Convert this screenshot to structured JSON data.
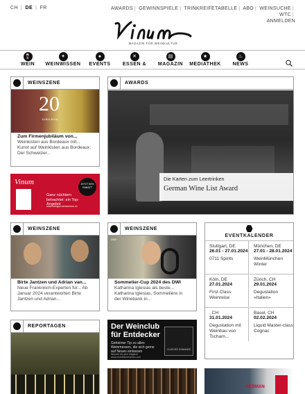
{
  "languages": [
    {
      "code": "CH",
      "active": false
    },
    {
      "code": "DE",
      "active": true
    },
    {
      "code": "FR",
      "active": false
    }
  ],
  "top_links": [
    "AWARDS",
    "GEWINNSPIELE",
    "TRINKREIFETABELLE",
    "ABO",
    "WEINSUCHE",
    "WTC",
    "ANMELDEN"
  ],
  "logo": {
    "text": "Vinum",
    "tagline": "MAGAZIN FÜR WEINKULTUR"
  },
  "nav": [
    {
      "label": "WEIN",
      "icon": "wine-glass-icon"
    },
    {
      "label": "WEINWISSEN",
      "icon": "grape-icon"
    },
    {
      "label": "EVENTS",
      "icon": "balloon-icon"
    },
    {
      "label": "ESSEN &",
      "icon": "cutlery-icon"
    },
    {
      "label": "MAGAZIN",
      "icon": "magazine-icon"
    },
    {
      "label": "MEDIATHEK",
      "icon": "star-icon"
    },
    {
      "label": "NEWS",
      "icon": "flame-icon"
    }
  ],
  "cards": {
    "weinszene1": {
      "category": "WEINSZENE",
      "image_text": "20",
      "image_subtext": "JUBILÄUM",
      "title": "Zum Firmenjubiläum von...",
      "text": "Weinkisten aus Bordeaux mit... Kunst auf Weinkisten aus Bordeaux: Der Schweizer..."
    },
    "awards": {
      "category": "AWARDS",
      "overlay_sub": "Die Karten zum Leertrinken",
      "overlay_title": "German Wine List Award"
    },
    "promo": {
      "logo": "Vinum",
      "text": "Ganz nüchtern betrachtet: ein Top-Angebot",
      "subtext": "Jetzt bestellen unter: www.vinum.ch",
      "url": "www.weingut-weinschenk.ch",
      "badge": "JETZT 50% RABATT"
    },
    "weinszene2": {
      "category": "WEINSZENE",
      "title": "Birte Jantzen und Adrian van...",
      "text": "Neue Frankreich-Experten für... Ab Januar 2024 verantworten Birte Jantzen und Adrian..."
    },
    "weinszene3": {
      "category": "WEINSZENE",
      "image_badge": "DWI",
      "title": "Sommelier-Cup 2024 des DWI",
      "text": "Katharina Iglesias als beste... Katharina Iglesias, Sommelière in der Winebank in..."
    },
    "reportagen": {
      "category": "REPORTAGEN"
    },
    "weinclub": {
      "title": "Der Weinclub für Entdecker",
      "text": "Geheimer Tip zu allen Weinmessen, die sich gerne auf Neues einlassen",
      "footer": "Wunder bis jetzt Mitglied! www.clubdesdomaines.com",
      "brand": "CLUB DES DOMAINES"
    },
    "bottom_right": {
      "label": "GERMAN"
    }
  },
  "events": {
    "title": "EVENTKALENDER",
    "items": [
      {
        "place": "Stuttgart, DE",
        "dates": "26.01 - 27.01.2024",
        "name": "0711 Spirits"
      },
      {
        "place": "München, DE",
        "dates": "27.01 - 28.01.2024",
        "name": "WeinMünchen Winter"
      },
      {
        "place": "Köln, DE",
        "dates": "27.01.2024",
        "name": "First Class Weinreise"
      },
      {
        "place": "Zürich, CH",
        "dates": "29.01.2024",
        "name": "Degustation «Italien»"
      },
      {
        "place": ", CH",
        "dates": "31.01.2024",
        "name": "Degustation mit Weinbau von Tscharn..."
      },
      {
        "place": "Basel, CH",
        "dates": "02.02.2024",
        "name": "Liquid Master-class Cognac"
      }
    ]
  },
  "colors": {
    "accent_red": "#c8102e",
    "text_dark": "#111111",
    "border": "#999999"
  }
}
